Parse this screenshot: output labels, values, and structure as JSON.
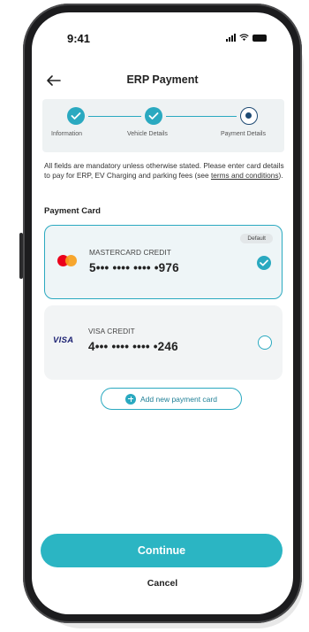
{
  "status_bar": {
    "time": "9:41"
  },
  "header": {
    "title": "ERP Payment"
  },
  "stepper": {
    "steps": [
      {
        "label": "Information",
        "state": "done"
      },
      {
        "label": "Vehicle Details",
        "state": "done"
      },
      {
        "label": "Payment Details",
        "state": "active"
      }
    ]
  },
  "description": {
    "text_before": "All fields are mandatory unless otherwise stated. Please enter card details to pay for ERP, EV Charging and parking fees (see ",
    "link_text": "terms and conditions",
    "text_after": ")."
  },
  "section_label": "Payment Card",
  "cards": [
    {
      "type": "MASTERCARD CREDIT",
      "number": "5••• •••• •••• •976",
      "badge": "Default",
      "brand": "mastercard",
      "selected": true
    },
    {
      "type": "VISA CREDIT",
      "number": "4••• •••• •••• •246",
      "brand": "visa",
      "brand_label": "VISA",
      "selected": false
    }
  ],
  "add_card_label": "Add new payment card",
  "continue_label": "Continue",
  "cancel_label": "Cancel",
  "colors": {
    "accent": "#2aa9c0",
    "button": "#2bb5c3",
    "active_step": "#1e4a73",
    "phone_frame": "#1c1c1e"
  }
}
